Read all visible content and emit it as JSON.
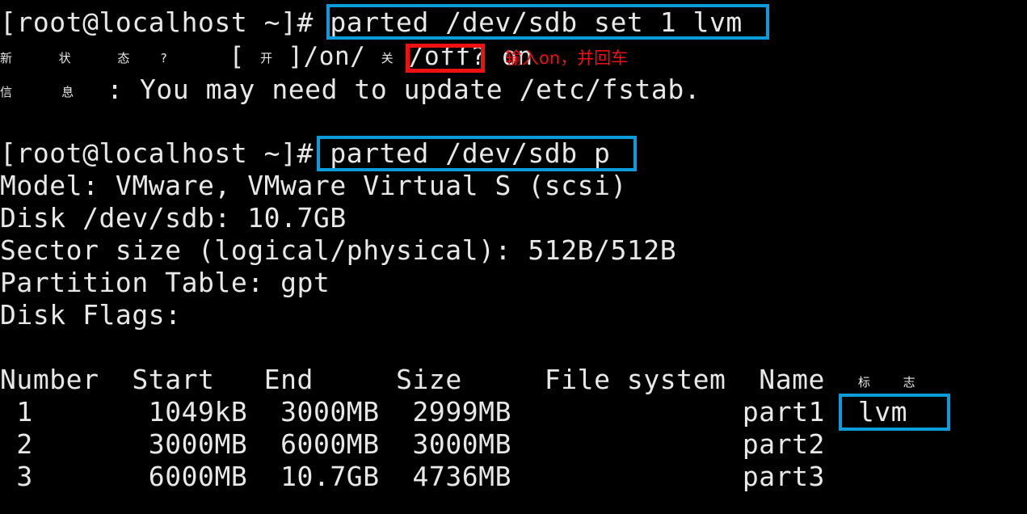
{
  "terminal": {
    "background_color": "#000000",
    "text_color": "#e8e8e8",
    "prompt": "[root@localhost ~]# ",
    "lines": {
      "prompt1": "[root@localhost ~]# ",
      "command1": "parted /dev/sdb set 1 lvm",
      "state_prompt_cjk_new": "新",
      "state_prompt_cjk_state": "状",
      "state_prompt_cjk_tai": "态",
      "state_prompt_q": "?",
      "state_bracket_open": "[",
      "state_cjk_on": "开",
      "state_bracket_close": "]/on/",
      "state_cjk_off": "关",
      "state_off": "/off?",
      "state_answer": "on",
      "info_cjk_xin": "信",
      "info_cjk_xi": "息",
      "info_text": ": You may need to update /etc/fstab.",
      "prompt2": "[root@localhost ~]# ",
      "command2": "parted /dev/sdb p",
      "model": "Model: VMware, VMware Virtual S (scsi)",
      "disk": "Disk /dev/sdb: 10.7GB",
      "sector": "Sector size (logical/physical): 512B/512B",
      "partition_table": "Partition Table: gpt",
      "disk_flags": "Disk Flags:"
    }
  },
  "table": {
    "headers": {
      "number": "Number",
      "start": "Start",
      "end": "End",
      "size": "Size",
      "file_system": "File system",
      "name": "Name",
      "flags_cjk_biao": "标",
      "flags_cjk_zhi": "志"
    },
    "rows": [
      {
        "number": "1",
        "start": "1049kB",
        "end": "3000MB",
        "size": "2999MB",
        "file_system": "",
        "name": "part1",
        "flags": "lvm"
      },
      {
        "number": "2",
        "start": "3000MB",
        "end": "6000MB",
        "size": "3000MB",
        "file_system": "",
        "name": "part2",
        "flags": ""
      },
      {
        "number": "3",
        "start": "6000MB",
        "end": "10.7GB",
        "size": "4736MB",
        "file_system": "",
        "name": "part3",
        "flags": ""
      }
    ]
  },
  "annotations": {
    "blue_color": "#0d9cdb",
    "red_color": "#ee1111",
    "red_note": "输入on，并回车",
    "highlight_command1": "parted /dev/sdb set 1 lvm",
    "highlight_answer": "on",
    "highlight_command2": "parted /dev/sdb p",
    "highlight_flag": "lvm"
  }
}
